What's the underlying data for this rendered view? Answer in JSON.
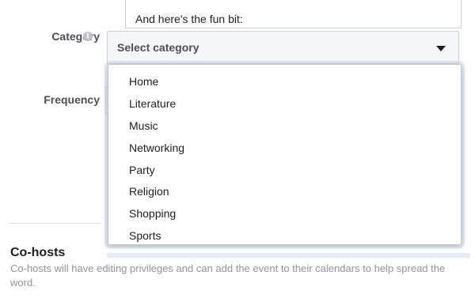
{
  "description": {
    "visible_text": "And here's the fun bit:"
  },
  "category": {
    "label": "Category",
    "info_glyph": "i",
    "select_text": "Select category",
    "options": [
      "Home",
      "Literature",
      "Music",
      "Networking",
      "Party",
      "Religion",
      "Shopping",
      "Sports"
    ]
  },
  "frequency": {
    "label": "Frequency"
  },
  "cohosts": {
    "title": "Co-hosts",
    "description": "Co-hosts will have editing privileges and can add the event to their calendars to help spread the word."
  },
  "icons": {
    "info": "info-icon",
    "caret": "caret-down-icon"
  },
  "colors": {
    "text": "#1c1e21",
    "label": "#4b4f56",
    "muted": "#90949c",
    "border": "#ccd0d5"
  }
}
